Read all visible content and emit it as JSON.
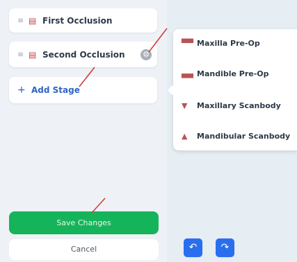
{
  "stages": [
    {
      "label": "First Occlusion"
    },
    {
      "label": "Second Occlusion"
    }
  ],
  "add_stage_label": "Add Stage",
  "save_label": "Save Changes",
  "cancel_label": "Cancel",
  "menu_items": [
    {
      "label": "Maxilla Pre-Op",
      "icon": "maxilla-preop-icon"
    },
    {
      "label": "Mandible Pre-Op",
      "icon": "mandible-preop-icon"
    },
    {
      "label": "Maxillary Scanbody",
      "icon": "maxillary-scanbody-icon"
    },
    {
      "label": "Mandibular Scanbody",
      "icon": "mandibular-scanbody-icon"
    }
  ],
  "colors": {
    "save_green": "#16b45a",
    "accent_blue": "#2a6ef0",
    "link_blue": "#2e63c8",
    "annotation_red": "#d33c3c"
  }
}
